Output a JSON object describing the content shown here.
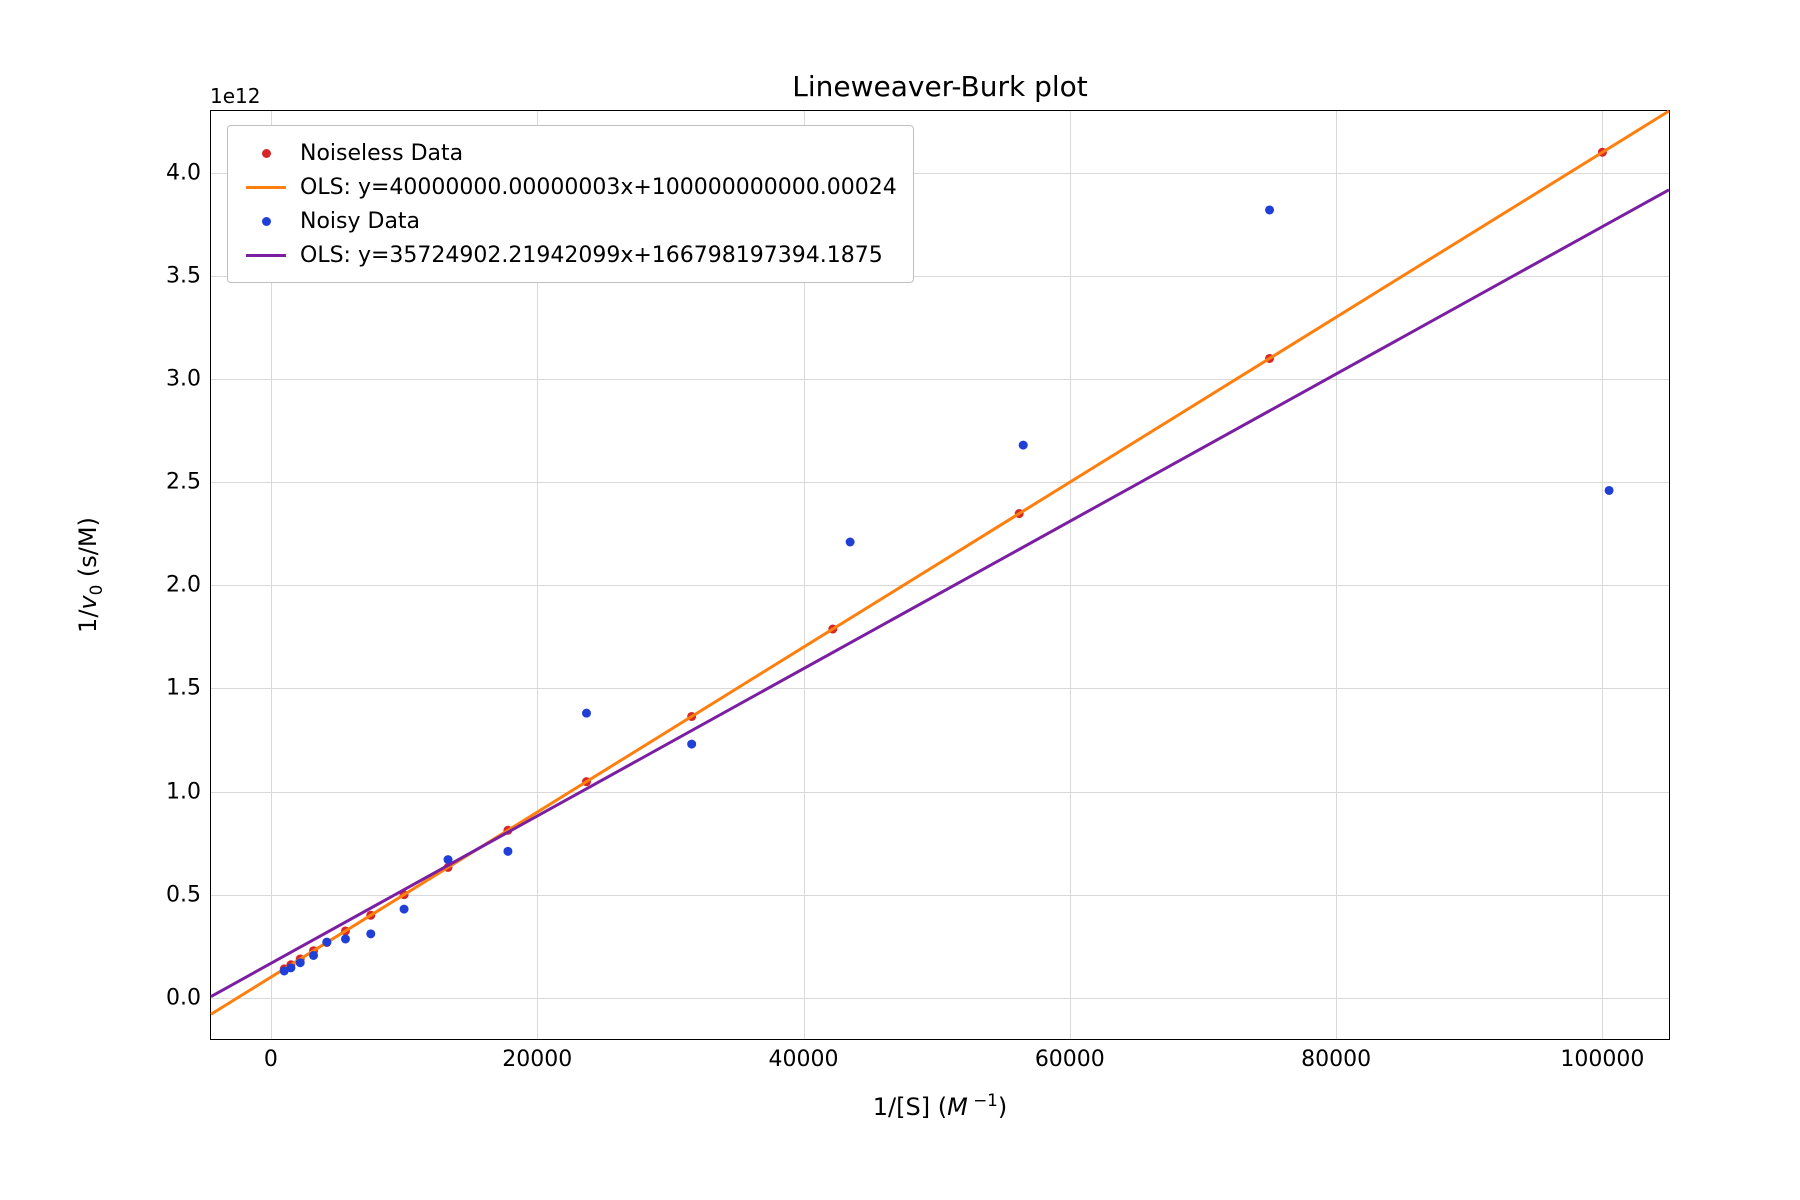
{
  "chart_data": {
    "type": "scatter",
    "title": "Lineweaver-Burk plot",
    "xlabel": "1/[S] (M⁻¹)",
    "ylabel": "1/v₀ (s/M)",
    "xlim": [
      -4500,
      105000
    ],
    "ylim": [
      -200000000000.0,
      4300000000000.0
    ],
    "y_offset_text": "1e12",
    "x_ticks": [
      0,
      20000,
      40000,
      60000,
      80000,
      100000
    ],
    "y_ticks": [
      0.0,
      0.5,
      1.0,
      1.5,
      2.0,
      2.5,
      3.0,
      3.5,
      4.0
    ],
    "y_tick_scale": 1000000000000.0,
    "series": [
      {
        "name": "Noiseless Data",
        "render": "scatter",
        "color": "#d62728",
        "marker_radius": 4.5,
        "x": [
          1000,
          1500,
          2200,
          3200,
          4200,
          5600,
          7500,
          10000,
          13300,
          17800,
          23700,
          31600,
          42200,
          56200,
          75000,
          100000
        ],
        "y": [
          140000000000.0,
          160000000000.0,
          188000000000.0,
          228000000000.0,
          268000000000.0,
          324000000000.0,
          400000000000.0,
          500000000000.0,
          632000000000.0,
          812000000000.0,
          1048000000000.0,
          1364000000000.0,
          1788000000000.0,
          2348000000000.0,
          3100000000000.0,
          4100000000000.0
        ]
      },
      {
        "name": "OLS: y=40000000.00000003x+100000000000.00024",
        "render": "line",
        "color": "#ff7f0e",
        "width": 3,
        "slope": 40000000.00000003,
        "intercept": 100000000000.00024
      },
      {
        "name": "Noisy Data",
        "render": "scatter",
        "color": "#1f3fd6",
        "marker_radius": 4.5,
        "x": [
          1000,
          1500,
          2200,
          3200,
          4200,
          5600,
          7500,
          10000,
          13300,
          17800,
          23700,
          31600,
          43500,
          56500,
          75000,
          100500
        ],
        "y": [
          130000000000.0,
          145000000000.0,
          170000000000.0,
          205000000000.0,
          270000000000.0,
          285000000000.0,
          310000000000.0,
          430000000000.0,
          670000000000.0,
          710000000000.0,
          1380000000000.0,
          1230000000000.0,
          2210000000000.0,
          2680000000000.0,
          3820000000000.0,
          2460000000000.0
        ]
      },
      {
        "name": "OLS: y=35724902.21942099x+166798197394.1875",
        "render": "line",
        "color": "#7b1fa2",
        "width": 3,
        "slope": 35724902.21942099,
        "intercept": 166798197394.1875
      }
    ],
    "legend": [
      "Noiseless Data",
      "OLS: y=40000000.00000003x+100000000000.00024",
      "Noisy Data",
      "OLS: y=35724902.21942099x+166798197394.1875"
    ]
  }
}
